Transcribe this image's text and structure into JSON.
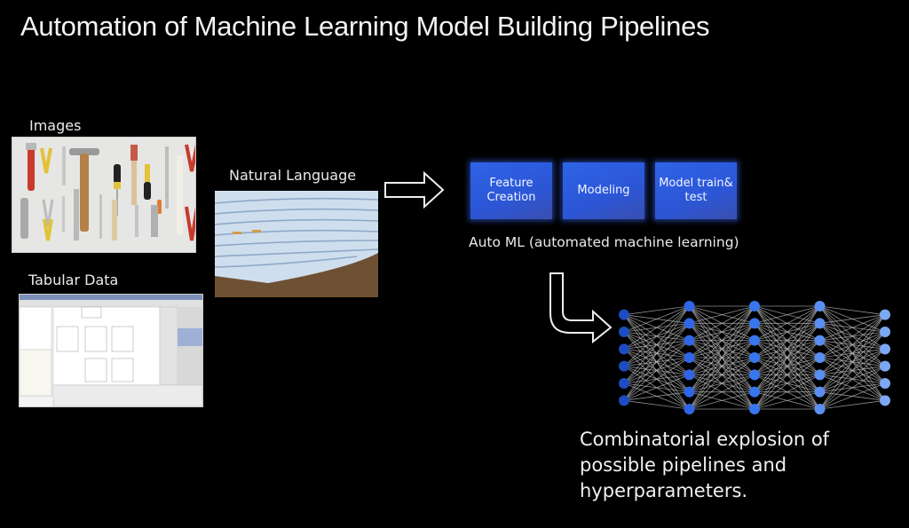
{
  "slide": {
    "title": "Automation of Machine Learning Model Building Pipelines"
  },
  "inputs": {
    "images_label": "Images",
    "images_thumbnail": "hand-tools-photo",
    "tabular_label": "Tabular Data",
    "tabular_thumbnail": "database-schema-screenshot",
    "natural_language_label": "Natural Language",
    "natural_language_thumbnail": "stacked-documents-photo"
  },
  "automl": {
    "steps": [
      {
        "line1": "Feature",
        "line2": "Creation"
      },
      {
        "line1": "Modeling",
        "line2": ""
      },
      {
        "line1": "Model train&",
        "line2": "test"
      }
    ],
    "caption": "Auto ML (automated machine learning)",
    "box_color": "#2b5ce0"
  },
  "network": {
    "layers": [
      {
        "nodes": 6,
        "color": "#1d4cc0"
      },
      {
        "nodes": 7,
        "color": "#2e66e6"
      },
      {
        "nodes": 7,
        "color": "#3776ee"
      },
      {
        "nodes": 7,
        "color": "#5a8ef0"
      },
      {
        "nodes": 6,
        "color": "#7ca8f3"
      }
    ],
    "edge_color": "#bdbdbd"
  },
  "conclusion": {
    "lines": [
      "Combinatorial explosion of",
      "possible pipelines and",
      "hyperparameters."
    ]
  },
  "icons": {
    "right_arrow": "outline-right-arrow-icon",
    "turn_arrow": "outline-down-right-arrow-icon"
  }
}
